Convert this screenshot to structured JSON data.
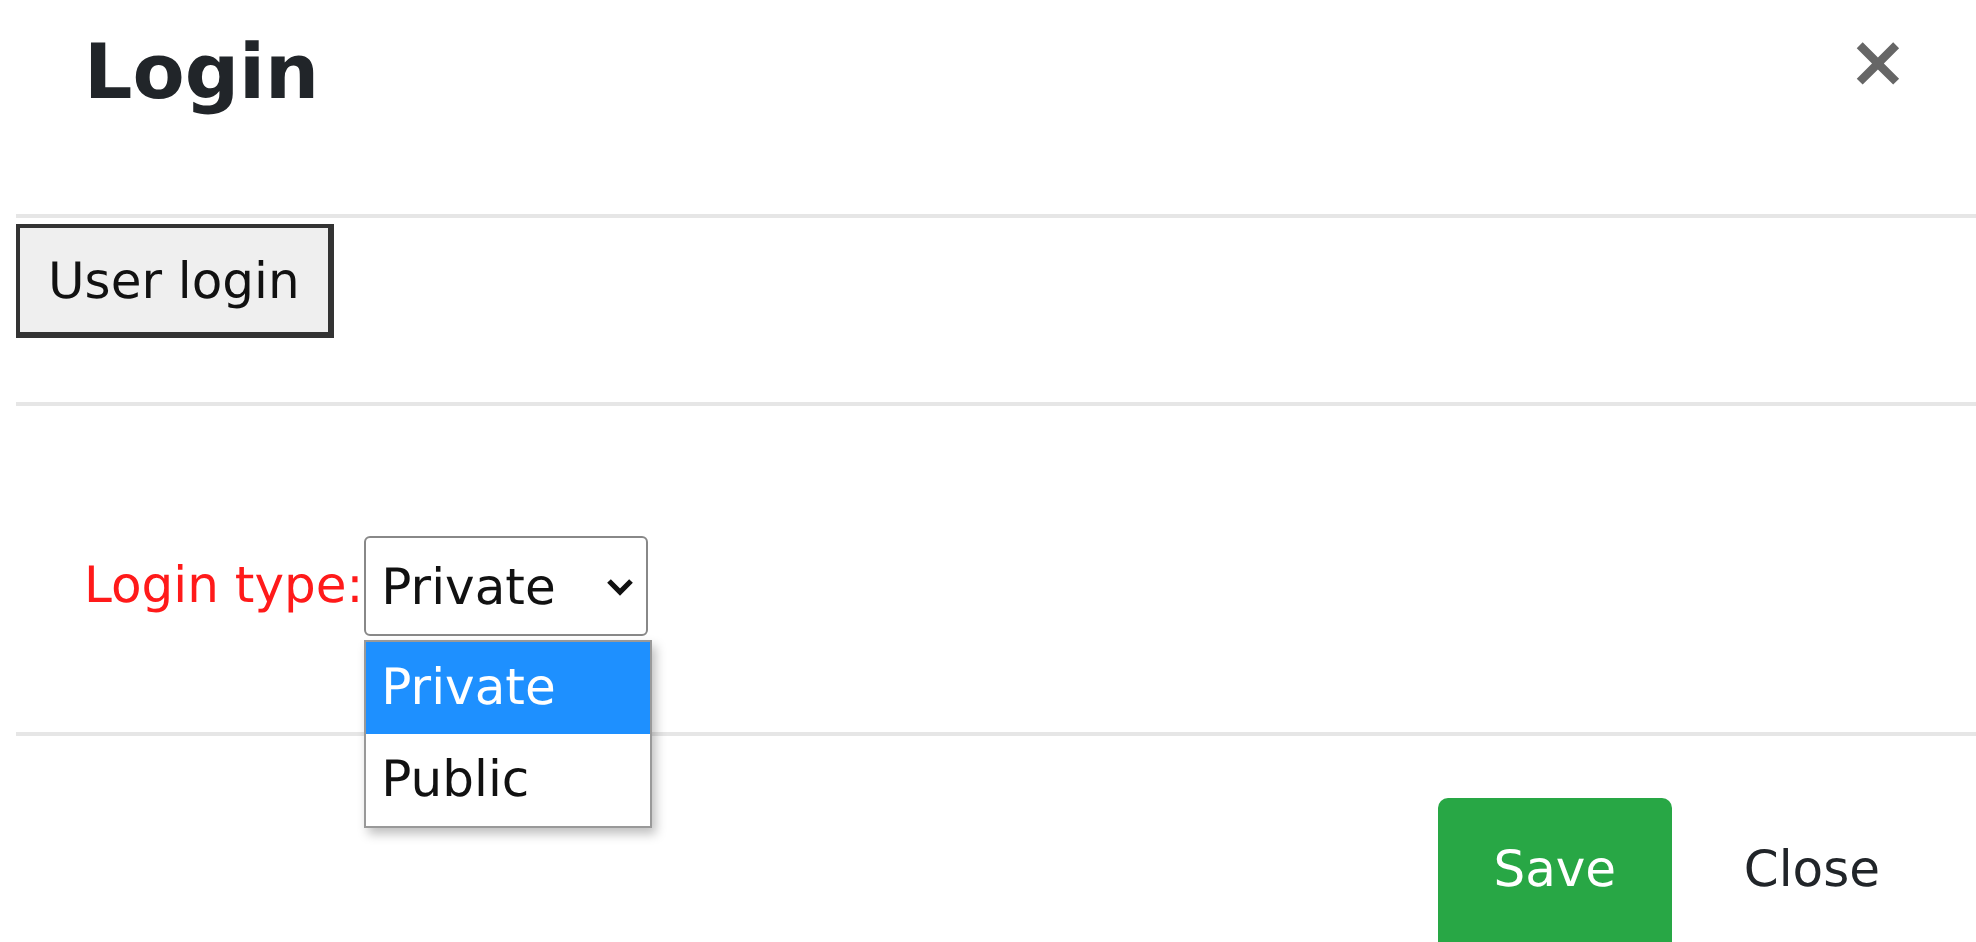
{
  "dialog": {
    "title": "Login",
    "close_glyph": "×"
  },
  "section_button": {
    "label": "User login"
  },
  "field": {
    "label": "Login type:",
    "value": "Private",
    "expanded": true,
    "options": [
      {
        "label": "Private",
        "selected": true
      },
      {
        "label": "Public",
        "selected": false
      }
    ]
  },
  "footer_buttons": [
    {
      "label": "Save",
      "kind": "primary"
    },
    {
      "label": "Close",
      "kind": "plain"
    }
  ]
}
